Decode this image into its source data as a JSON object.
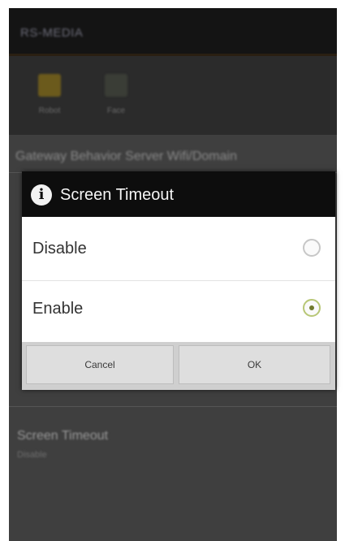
{
  "app": {
    "title": "RS-MEDIA"
  },
  "toolbar": {
    "items": [
      {
        "label": "Robot",
        "icon": "robot-icon",
        "color": "#6b5a1c"
      },
      {
        "label": "Face",
        "icon": "face-icon",
        "color": "#3a3d36"
      }
    ]
  },
  "background_list": {
    "tabs_text": "Gateway  Behavior  Server  Wifi/Domain",
    "item_title": "Screen Timeout",
    "item_subtitle": "Disable"
  },
  "dialog": {
    "title": "Screen Timeout",
    "icon": "info-icon",
    "options": [
      {
        "label": "Disable",
        "checked": false
      },
      {
        "label": "Enable",
        "checked": true
      }
    ],
    "cancel_label": "Cancel",
    "ok_label": "OK"
  },
  "colors": {
    "header_bg": "#0d0d0d",
    "radio_checked": "#6f7a2c",
    "overlay": "#4a4a4a"
  }
}
